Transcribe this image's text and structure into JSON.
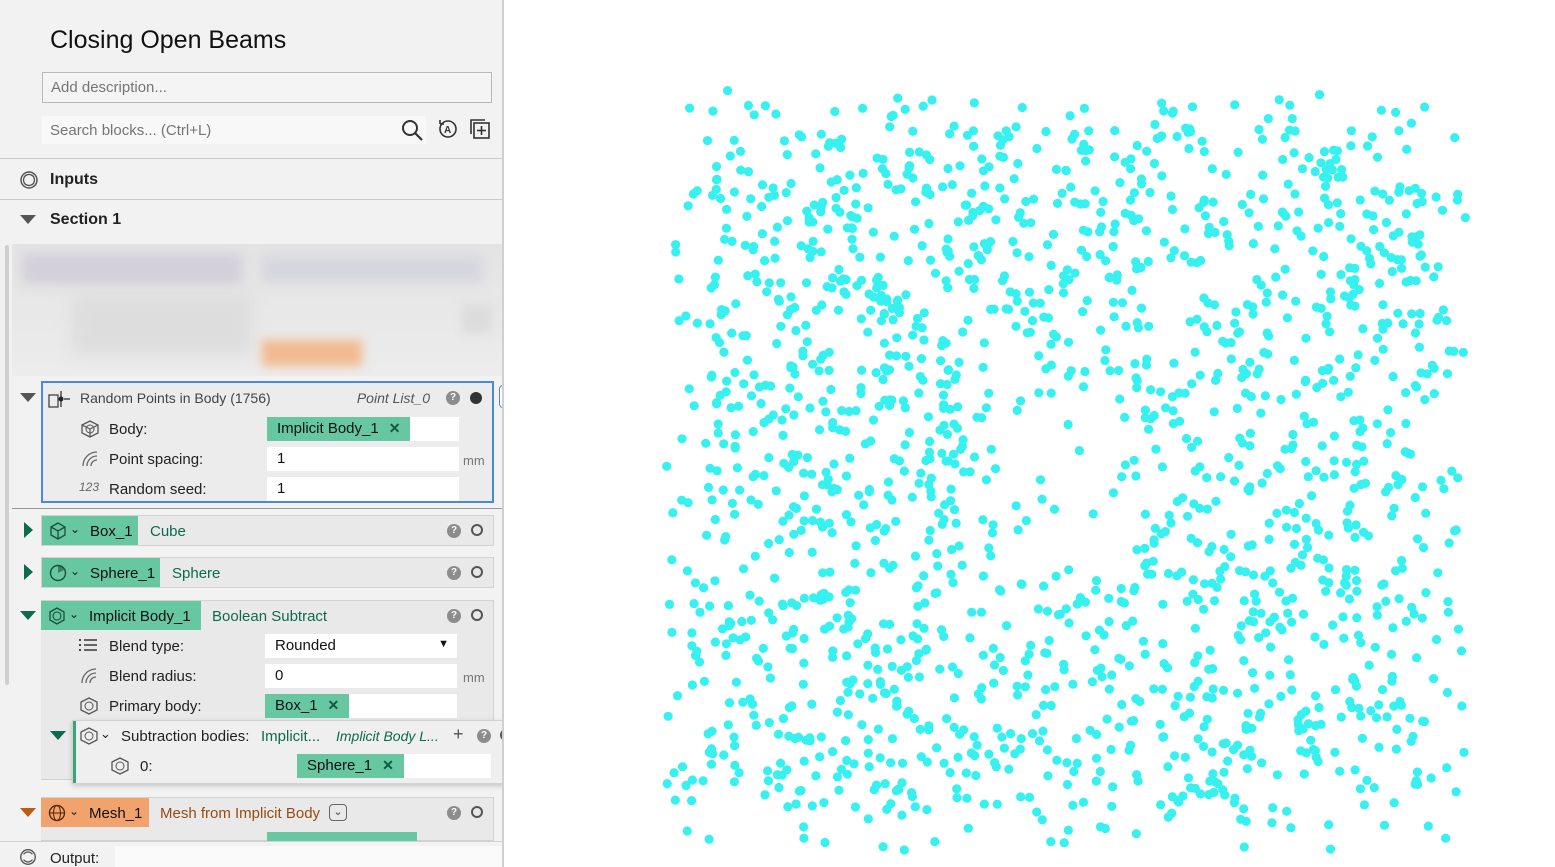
{
  "panel": {
    "title": "Closing Open Beams",
    "description_placeholder": "Add description...",
    "search_placeholder": "Search blocks... (Ctrl+L)",
    "inputs_label": "Inputs",
    "section_label": "Section 1",
    "output_label": "Output:"
  },
  "random_points": {
    "title": "Random Points in Body (1756)",
    "output_name": "Point List_0",
    "params": [
      {
        "label": "Body:",
        "value": "Implicit Body_1",
        "kind": "chip",
        "icon": "implicit-body-icon"
      },
      {
        "label": "Point spacing:",
        "value": "1",
        "unit": "mm",
        "kind": "number",
        "icon": "spacing-icon"
      },
      {
        "label": "Random seed:",
        "value": "1",
        "kind": "number",
        "icon": "number-icon"
      }
    ]
  },
  "box_block": {
    "name": "Box_1",
    "type": "Cube"
  },
  "sphere_block": {
    "name": "Sphere_1",
    "type": "Sphere"
  },
  "implicit_block": {
    "name": "Implicit Body_1",
    "type": "Boolean Subtract",
    "blend_type_label": "Blend type:",
    "blend_type_value": "Rounded",
    "blend_radius_label": "Blend radius:",
    "blend_radius_value": "0",
    "blend_radius_unit": "mm",
    "primary_label": "Primary body:",
    "primary_value": "Box_1",
    "subtraction_label": "Subtraction bodies:",
    "subtraction_value": "Implicit...",
    "subtraction_type": "Implicit Body L...",
    "list_index": "0:",
    "list_value": "Sphere_1"
  },
  "mesh_block": {
    "name": "Mesh_1",
    "type": "Mesh from Implicit Body"
  },
  "icons": {
    "remove": "✕",
    "plus": "+",
    "help": "?",
    "dropdown": "▼"
  },
  "colors": {
    "points": "#37f0f0",
    "chip_green": "#66c7a1",
    "chip_orange": "#f2a36d",
    "selection": "#4a88d9"
  },
  "viewport": {
    "point_count": 1756,
    "point_color": "#37f0f0"
  }
}
